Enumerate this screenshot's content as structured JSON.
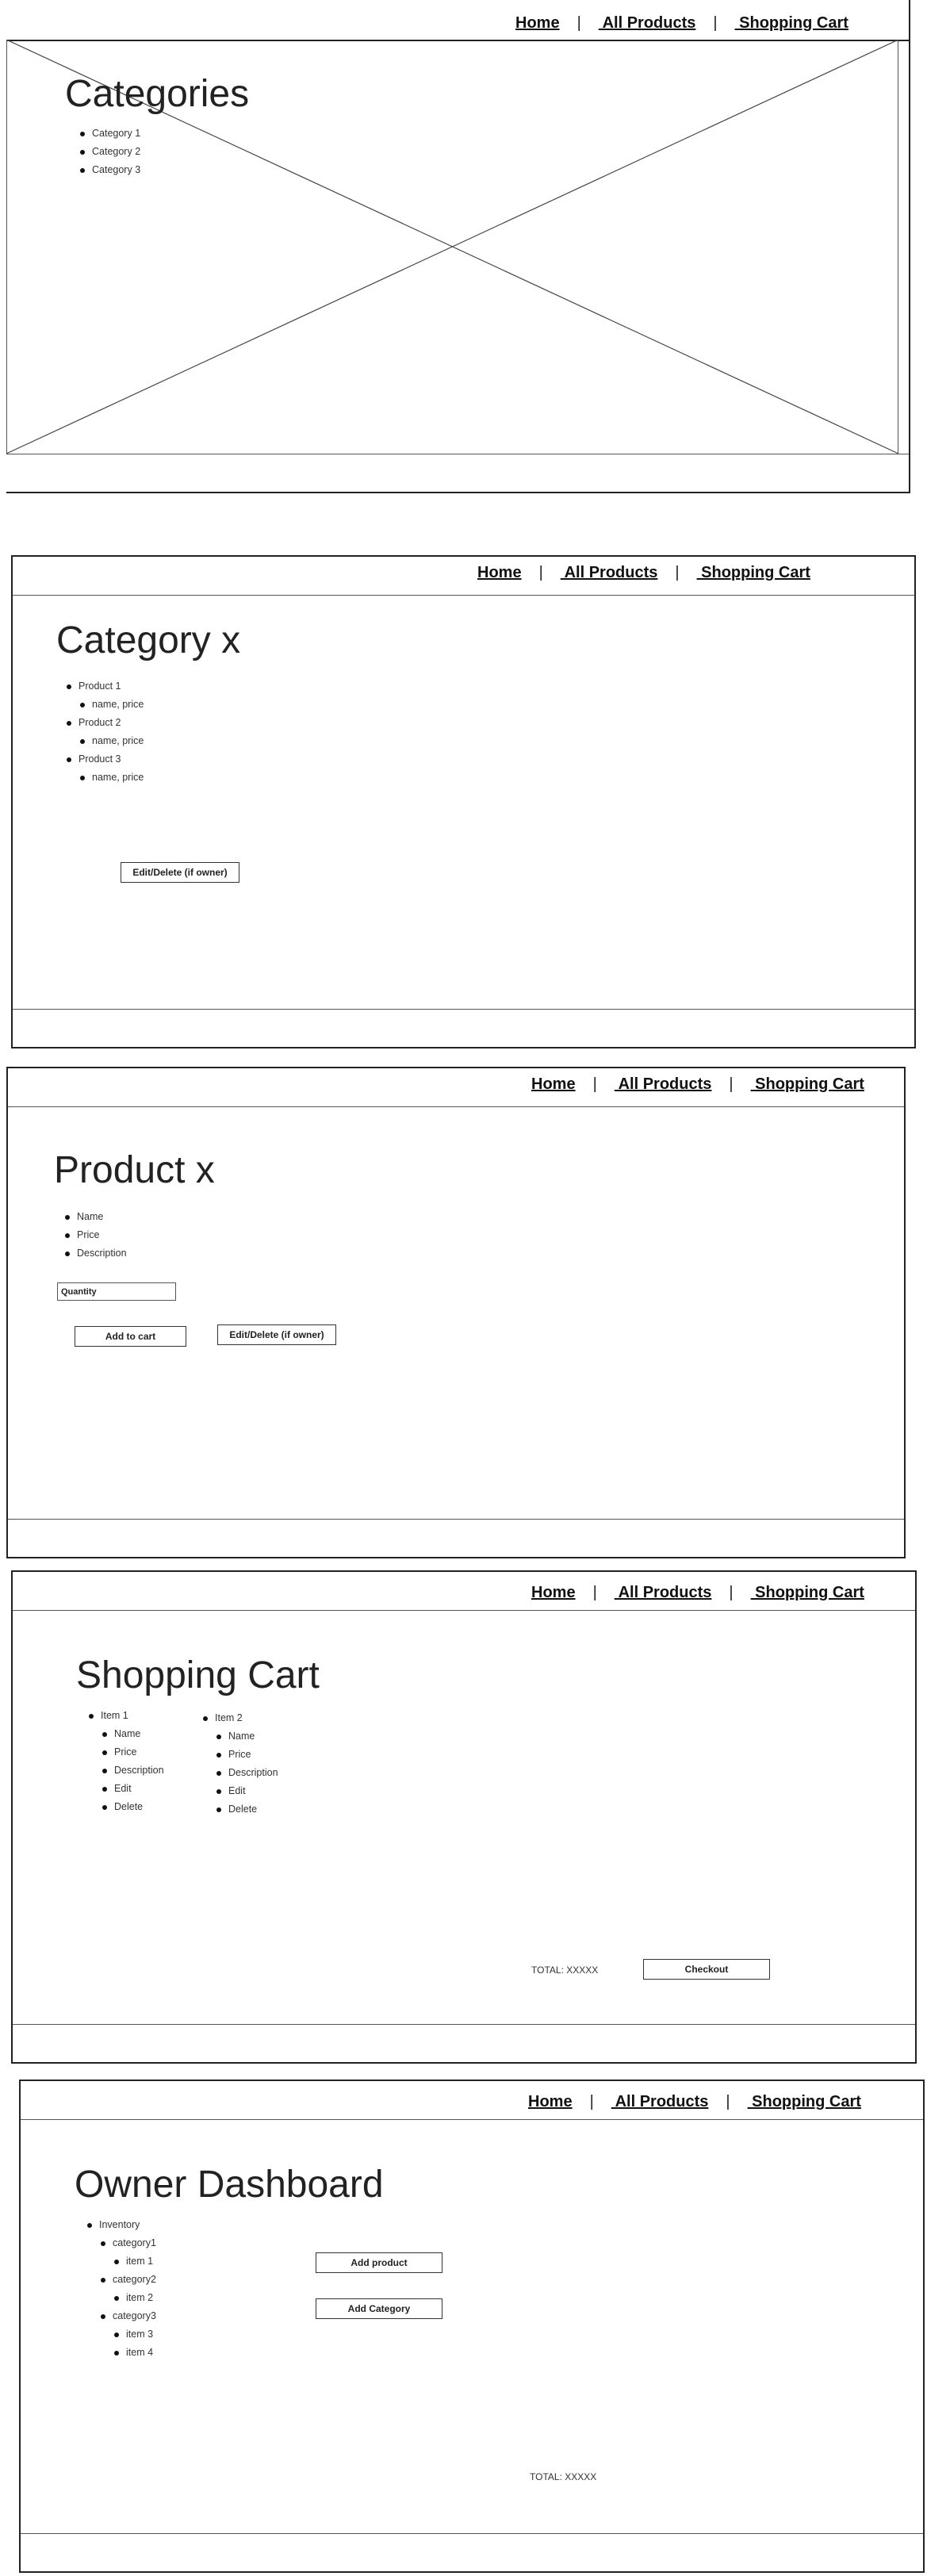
{
  "nav": {
    "home": "Home",
    "sep": "|",
    "all_products": " All Products",
    "cart": " Shopping Cart"
  },
  "categories_page": {
    "title": "Categories",
    "items": [
      "Category 1",
      "Category 2",
      "Category 3"
    ]
  },
  "category_page": {
    "title": "Category x",
    "items": [
      {
        "label": "Product 1",
        "detail": "name, price"
      },
      {
        "label": "Product 2",
        "detail": "name, price"
      },
      {
        "label": "Product 3",
        "detail": "name, price"
      }
    ],
    "edit_button": "Edit/Delete (if owner)"
  },
  "product_page": {
    "title": "Product x",
    "fields": [
      "Name",
      "Price",
      "Description"
    ],
    "quantity_placeholder": "Quantity",
    "add_to_cart": "Add to cart",
    "edit_button": "Edit/Delete (if owner)"
  },
  "cart_page": {
    "title": "Shopping Cart",
    "items": [
      {
        "label": "Item 1",
        "details": [
          "Name",
          "Price",
          "Description",
          "Edit",
          "Delete"
        ]
      },
      {
        "label": "Item 2",
        "details": [
          "Name",
          "Price",
          "Description",
          "Edit",
          "Delete"
        ]
      }
    ],
    "total": "TOTAL: XXXXX",
    "checkout": "Checkout"
  },
  "dashboard_page": {
    "title": "Owner Dashboard",
    "inventory_label": "Inventory",
    "categories": [
      {
        "label": "category1",
        "items": [
          "item 1"
        ]
      },
      {
        "label": "category2",
        "items": [
          "item 2"
        ]
      },
      {
        "label": "category3",
        "items": [
          "item 3",
          "item 4"
        ]
      }
    ],
    "add_product": "Add product",
    "add_category": "Add Category",
    "total": "TOTAL: XXXXX"
  }
}
